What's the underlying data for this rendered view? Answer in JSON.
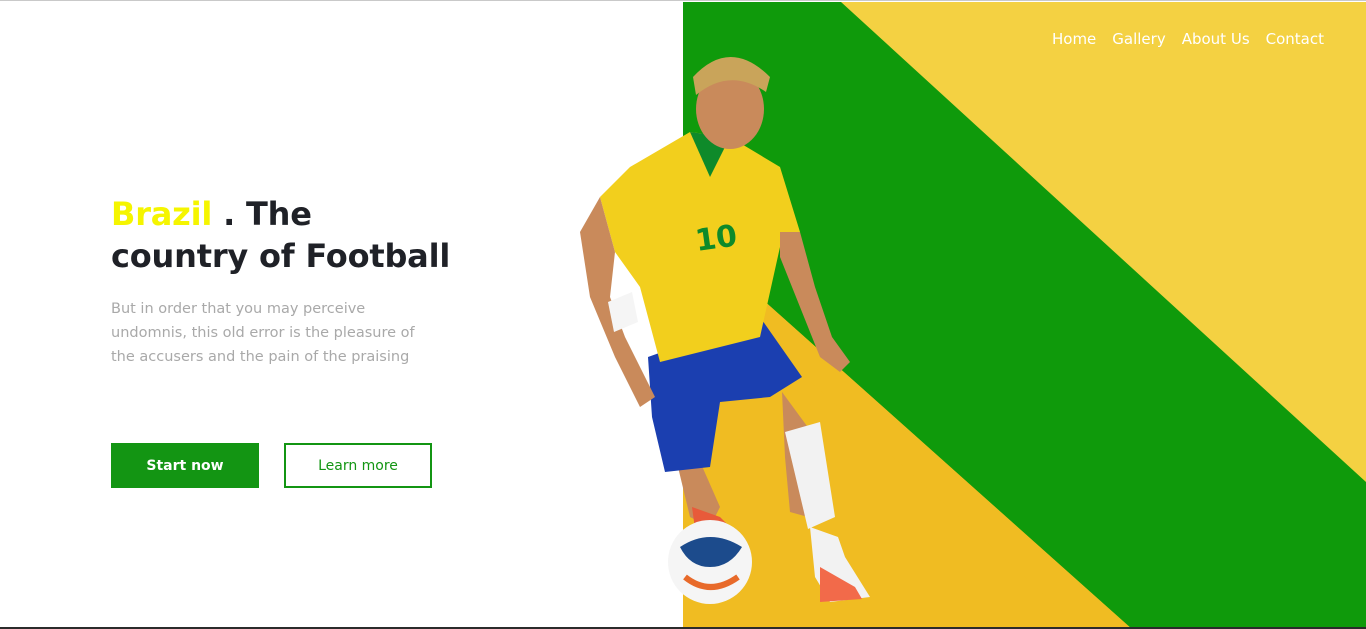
{
  "nav": {
    "items": [
      {
        "label": "Home"
      },
      {
        "label": "Gallery"
      },
      {
        "label": "About Us"
      },
      {
        "label": "Contact"
      }
    ]
  },
  "hero": {
    "headline_accent": "Brazil",
    "headline_rest": " . The country of Football",
    "description": "But in order that you may perceive undomnis, this old error is the pleasure of the accusers and the pain of the praising",
    "primary_button": "Start now",
    "secondary_button": "Learn more"
  },
  "colors": {
    "green": "#0f9a0b",
    "yellow": "#f4d142",
    "dark_yellow": "#f0bc22",
    "accent_yellow": "#f5f500",
    "button_green": "#139513"
  },
  "illustration": {
    "icon": "football-player-illustration",
    "jersey_number": "10"
  }
}
